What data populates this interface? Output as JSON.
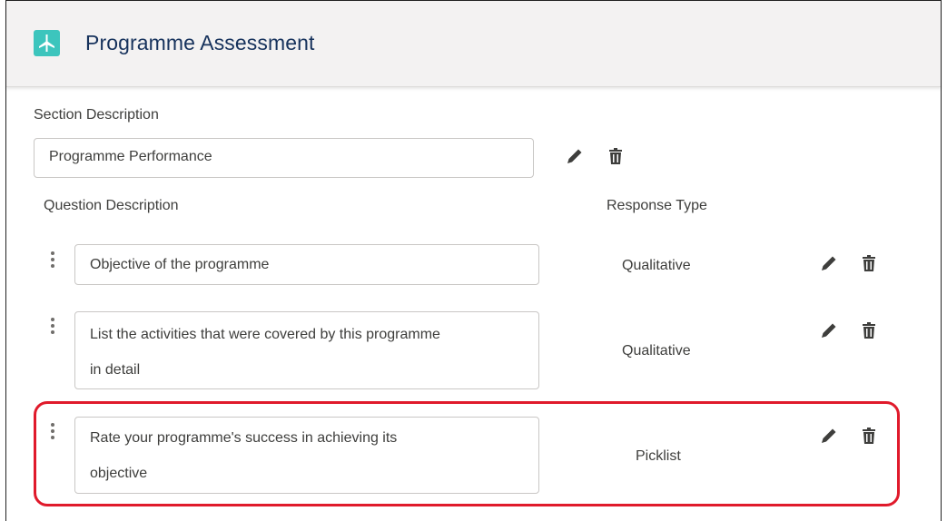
{
  "header": {
    "title": "Programme Assessment",
    "icon": "app-icon"
  },
  "section": {
    "label": "Section Description",
    "value": "Programme Performance"
  },
  "columns": {
    "question": "Question Description",
    "response": "Response Type"
  },
  "questions": [
    {
      "lines": [
        "Objective of the programme"
      ],
      "response": "Qualitative"
    },
    {
      "lines": [
        "List the activities that were covered by this programme",
        "in detail"
      ],
      "response": "Qualitative"
    },
    {
      "lines": [
        "Rate your programme's success in achieving its",
        "objective"
      ],
      "response": "Picklist",
      "highlighted": true
    }
  ],
  "colors": {
    "accent": "#3cc5bd",
    "highlight": "#e01a2b",
    "title": "#16325c"
  },
  "icons": [
    "edit-icon",
    "delete-icon",
    "drag-handle-icon"
  ]
}
